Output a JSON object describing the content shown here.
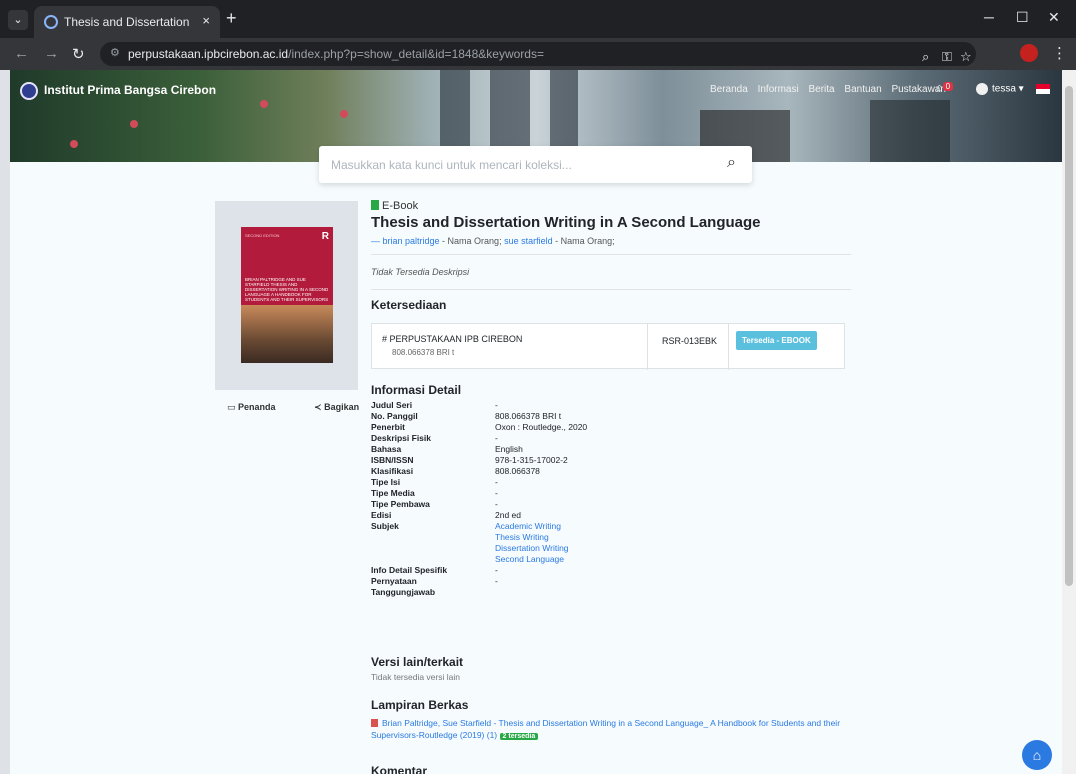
{
  "browser": {
    "tab_title": "Thesis and Dissertation Writing",
    "tab_close": "×",
    "new_tab": "+",
    "url_host": "perpustakaan.ipbcirebon.ac.id",
    "url_path": "/index.php?p=show_detail&id=1848&keywords="
  },
  "site": {
    "brand": "Institut Prima Bangsa Cirebon",
    "nav": [
      "Beranda",
      "Informasi",
      "Berita",
      "Bantuan",
      "Pustakawan"
    ],
    "cart_count": "0",
    "user": "tessa"
  },
  "search": {
    "placeholder": "Masukkan kata kunci untuk mencari koleksi..."
  },
  "cover": {
    "edition_text": "SECOND EDITION",
    "publisher_mark": "R",
    "title_text": "BRIAN PALTRIDGE AND SUE STARFIELD THESIS AND DISSERTATION WRITING IN A SECOND LANGUAGE A HANDBOOK FOR STUDENTS AND THEIR SUPERVISORS"
  },
  "actions": {
    "bookmark": "Penanda",
    "share": "Bagikan"
  },
  "book": {
    "type": "E-Book",
    "title": "Thesis and Dissertation Writing in A Second Language",
    "author1": "— brian paltridge",
    "author1_role": " - Nama Orang; ",
    "author2": "sue starfield",
    "author2_role": " - Nama Orang;",
    "description": "Tidak Tersedia Deskripsi"
  },
  "availability": {
    "heading": "Ketersediaan",
    "location": "# PERPUSTAKAAN IPB CIREBON",
    "call_number": "808.066378 BRI t",
    "item_code": "RSR-013EBK",
    "status": "Tersedia - EBOOK"
  },
  "detail": {
    "heading": "Informasi Detail",
    "rows": [
      {
        "k": "Judul Seri",
        "v": "-"
      },
      {
        "k": "No. Panggil",
        "v": "808.066378 BRI t"
      },
      {
        "k": "Penerbit",
        "v": "Oxon : Routledge., 2020"
      },
      {
        "k": "Deskripsi Fisik",
        "v": "-"
      },
      {
        "k": "Bahasa",
        "v": "English"
      },
      {
        "k": "ISBN/ISSN",
        "v": "978-1-315-17002-2"
      },
      {
        "k": "Klasifikasi",
        "v": "808.066378"
      },
      {
        "k": "Tipe Isi",
        "v": "-"
      },
      {
        "k": "Tipe Media",
        "v": "-"
      },
      {
        "k": "Tipe Pembawa",
        "v": "-"
      },
      {
        "k": "Edisi",
        "v": "2nd ed"
      },
      {
        "k": "Subjek",
        "v": "Academic Writing"
      },
      {
        "k": "",
        "v": "Thesis Writing"
      },
      {
        "k": "",
        "v": "Dissertation Writing"
      },
      {
        "k": "",
        "v": "Second Language"
      },
      {
        "k": "Info Detail Spesifik",
        "v": "-"
      },
      {
        "k": "Pernyataan",
        "v": "-"
      },
      {
        "k": "Tanggungjawab",
        "v": ""
      }
    ]
  },
  "other_versions": {
    "heading": "Versi lain/terkait",
    "text": "Tidak tersedia versi lain"
  },
  "attachments": {
    "heading": "Lampiran Berkas",
    "file": "Brian Paltridge, Sue Starfield - Thesis and Dissertation Writing in a Second Language_ A Handbook for Students and their Supervisors-Routledge (2019) (1)",
    "badge": "2 tersedia"
  },
  "comments": {
    "heading": "Komentar"
  }
}
